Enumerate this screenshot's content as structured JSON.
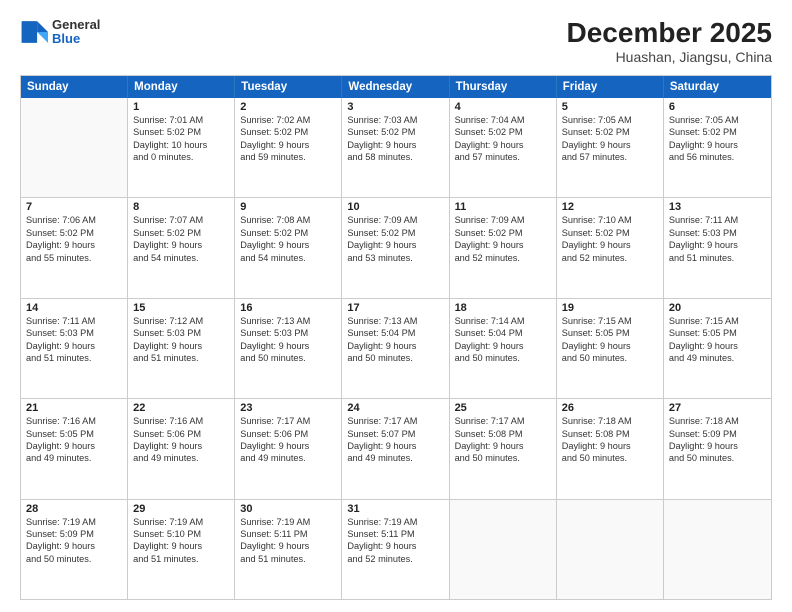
{
  "logo": {
    "general": "General",
    "blue": "Blue"
  },
  "title": "December 2025",
  "subtitle": "Huashan, Jiangsu, China",
  "header_days": [
    "Sunday",
    "Monday",
    "Tuesday",
    "Wednesday",
    "Thursday",
    "Friday",
    "Saturday"
  ],
  "weeks": [
    [
      {
        "day": "",
        "lines": []
      },
      {
        "day": "1",
        "lines": [
          "Sunrise: 7:01 AM",
          "Sunset: 5:02 PM",
          "Daylight: 10 hours",
          "and 0 minutes."
        ]
      },
      {
        "day": "2",
        "lines": [
          "Sunrise: 7:02 AM",
          "Sunset: 5:02 PM",
          "Daylight: 9 hours",
          "and 59 minutes."
        ]
      },
      {
        "day": "3",
        "lines": [
          "Sunrise: 7:03 AM",
          "Sunset: 5:02 PM",
          "Daylight: 9 hours",
          "and 58 minutes."
        ]
      },
      {
        "day": "4",
        "lines": [
          "Sunrise: 7:04 AM",
          "Sunset: 5:02 PM",
          "Daylight: 9 hours",
          "and 57 minutes."
        ]
      },
      {
        "day": "5",
        "lines": [
          "Sunrise: 7:05 AM",
          "Sunset: 5:02 PM",
          "Daylight: 9 hours",
          "and 57 minutes."
        ]
      },
      {
        "day": "6",
        "lines": [
          "Sunrise: 7:05 AM",
          "Sunset: 5:02 PM",
          "Daylight: 9 hours",
          "and 56 minutes."
        ]
      }
    ],
    [
      {
        "day": "7",
        "lines": [
          "Sunrise: 7:06 AM",
          "Sunset: 5:02 PM",
          "Daylight: 9 hours",
          "and 55 minutes."
        ]
      },
      {
        "day": "8",
        "lines": [
          "Sunrise: 7:07 AM",
          "Sunset: 5:02 PM",
          "Daylight: 9 hours",
          "and 54 minutes."
        ]
      },
      {
        "day": "9",
        "lines": [
          "Sunrise: 7:08 AM",
          "Sunset: 5:02 PM",
          "Daylight: 9 hours",
          "and 54 minutes."
        ]
      },
      {
        "day": "10",
        "lines": [
          "Sunrise: 7:09 AM",
          "Sunset: 5:02 PM",
          "Daylight: 9 hours",
          "and 53 minutes."
        ]
      },
      {
        "day": "11",
        "lines": [
          "Sunrise: 7:09 AM",
          "Sunset: 5:02 PM",
          "Daylight: 9 hours",
          "and 52 minutes."
        ]
      },
      {
        "day": "12",
        "lines": [
          "Sunrise: 7:10 AM",
          "Sunset: 5:02 PM",
          "Daylight: 9 hours",
          "and 52 minutes."
        ]
      },
      {
        "day": "13",
        "lines": [
          "Sunrise: 7:11 AM",
          "Sunset: 5:03 PM",
          "Daylight: 9 hours",
          "and 51 minutes."
        ]
      }
    ],
    [
      {
        "day": "14",
        "lines": [
          "Sunrise: 7:11 AM",
          "Sunset: 5:03 PM",
          "Daylight: 9 hours",
          "and 51 minutes."
        ]
      },
      {
        "day": "15",
        "lines": [
          "Sunrise: 7:12 AM",
          "Sunset: 5:03 PM",
          "Daylight: 9 hours",
          "and 51 minutes."
        ]
      },
      {
        "day": "16",
        "lines": [
          "Sunrise: 7:13 AM",
          "Sunset: 5:03 PM",
          "Daylight: 9 hours",
          "and 50 minutes."
        ]
      },
      {
        "day": "17",
        "lines": [
          "Sunrise: 7:13 AM",
          "Sunset: 5:04 PM",
          "Daylight: 9 hours",
          "and 50 minutes."
        ]
      },
      {
        "day": "18",
        "lines": [
          "Sunrise: 7:14 AM",
          "Sunset: 5:04 PM",
          "Daylight: 9 hours",
          "and 50 minutes."
        ]
      },
      {
        "day": "19",
        "lines": [
          "Sunrise: 7:15 AM",
          "Sunset: 5:05 PM",
          "Daylight: 9 hours",
          "and 50 minutes."
        ]
      },
      {
        "day": "20",
        "lines": [
          "Sunrise: 7:15 AM",
          "Sunset: 5:05 PM",
          "Daylight: 9 hours",
          "and 49 minutes."
        ]
      }
    ],
    [
      {
        "day": "21",
        "lines": [
          "Sunrise: 7:16 AM",
          "Sunset: 5:05 PM",
          "Daylight: 9 hours",
          "and 49 minutes."
        ]
      },
      {
        "day": "22",
        "lines": [
          "Sunrise: 7:16 AM",
          "Sunset: 5:06 PM",
          "Daylight: 9 hours",
          "and 49 minutes."
        ]
      },
      {
        "day": "23",
        "lines": [
          "Sunrise: 7:17 AM",
          "Sunset: 5:06 PM",
          "Daylight: 9 hours",
          "and 49 minutes."
        ]
      },
      {
        "day": "24",
        "lines": [
          "Sunrise: 7:17 AM",
          "Sunset: 5:07 PM",
          "Daylight: 9 hours",
          "and 49 minutes."
        ]
      },
      {
        "day": "25",
        "lines": [
          "Sunrise: 7:17 AM",
          "Sunset: 5:08 PM",
          "Daylight: 9 hours",
          "and 50 minutes."
        ]
      },
      {
        "day": "26",
        "lines": [
          "Sunrise: 7:18 AM",
          "Sunset: 5:08 PM",
          "Daylight: 9 hours",
          "and 50 minutes."
        ]
      },
      {
        "day": "27",
        "lines": [
          "Sunrise: 7:18 AM",
          "Sunset: 5:09 PM",
          "Daylight: 9 hours",
          "and 50 minutes."
        ]
      }
    ],
    [
      {
        "day": "28",
        "lines": [
          "Sunrise: 7:19 AM",
          "Sunset: 5:09 PM",
          "Daylight: 9 hours",
          "and 50 minutes."
        ]
      },
      {
        "day": "29",
        "lines": [
          "Sunrise: 7:19 AM",
          "Sunset: 5:10 PM",
          "Daylight: 9 hours",
          "and 51 minutes."
        ]
      },
      {
        "day": "30",
        "lines": [
          "Sunrise: 7:19 AM",
          "Sunset: 5:11 PM",
          "Daylight: 9 hours",
          "and 51 minutes."
        ]
      },
      {
        "day": "31",
        "lines": [
          "Sunrise: 7:19 AM",
          "Sunset: 5:11 PM",
          "Daylight: 9 hours",
          "and 52 minutes."
        ]
      },
      {
        "day": "",
        "lines": []
      },
      {
        "day": "",
        "lines": []
      },
      {
        "day": "",
        "lines": []
      }
    ]
  ]
}
